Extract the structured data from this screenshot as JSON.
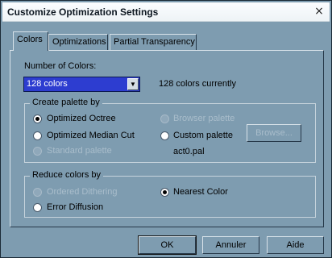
{
  "window": {
    "title": "Customize Optimization Settings",
    "close_symbol": "×"
  },
  "tabs": [
    {
      "label": "Colors",
      "active": true
    },
    {
      "label": "Optimizations",
      "active": false
    },
    {
      "label": "Partial Transparency",
      "active": false
    }
  ],
  "colors_tab": {
    "number_of_colors_label": "Number of Colors:",
    "number_of_colors_value": "128 colors",
    "colors_currently": "128 colors currently",
    "palette_group": {
      "legend": "Create palette by",
      "options": [
        {
          "label": "Optimized Octree",
          "checked": true,
          "enabled": true
        },
        {
          "label": "Optimized Median Cut",
          "checked": false,
          "enabled": true
        },
        {
          "label": "Standard palette",
          "checked": false,
          "enabled": false
        },
        {
          "label": "Browser palette",
          "checked": false,
          "enabled": false
        },
        {
          "label": "Custom palette",
          "checked": false,
          "enabled": true
        }
      ],
      "browse_label": "Browse...",
      "palette_file": "act0.pal"
    },
    "reduce_group": {
      "legend": "Reduce colors by",
      "options": [
        {
          "label": "Ordered Dithering",
          "checked": false,
          "enabled": false
        },
        {
          "label": "Error Diffusion",
          "checked": false,
          "enabled": true
        },
        {
          "label": "Nearest Color",
          "checked": true,
          "enabled": true
        }
      ]
    }
  },
  "footer": {
    "ok_label": "OK",
    "cancel_label": "Annuler",
    "help_label": "Aide"
  },
  "colors": {
    "window_bg": "#7e9cb0",
    "select_highlight": "#2d3dd0"
  }
}
